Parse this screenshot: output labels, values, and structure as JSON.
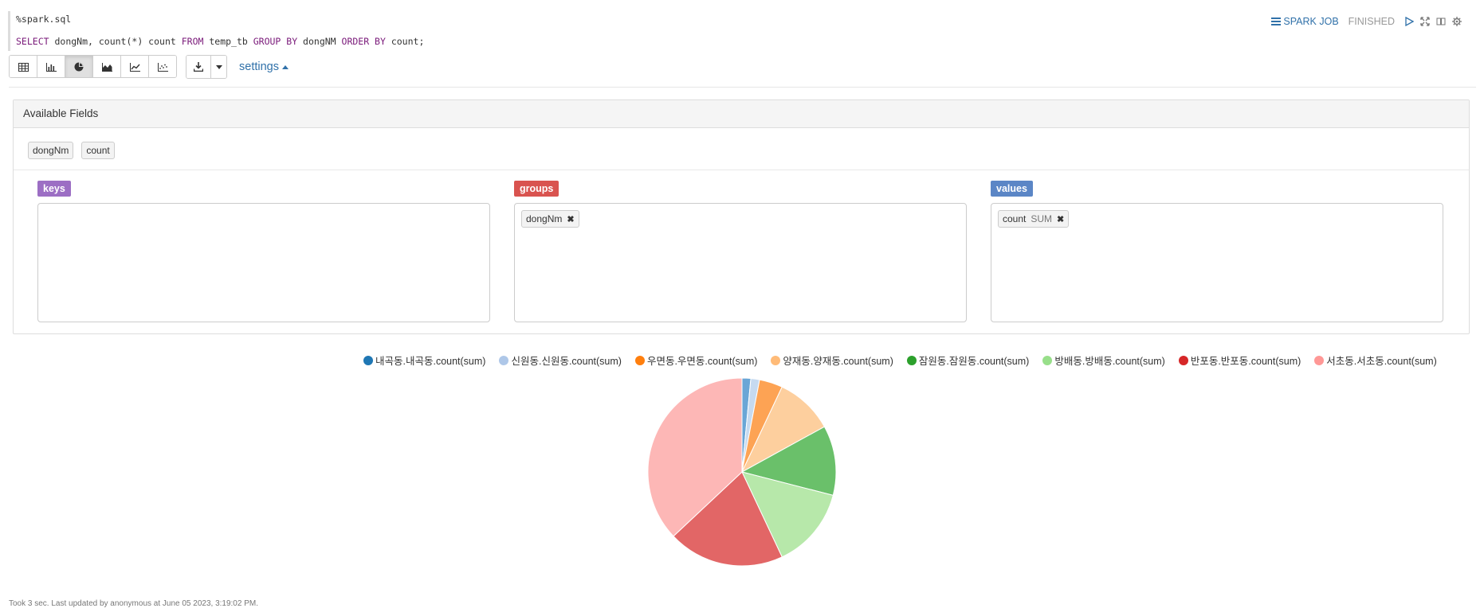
{
  "editor": {
    "interpreter": "%spark.sql",
    "query": {
      "select": "SELECT",
      "cols": " dongNm, count(*) count ",
      "from": "FROM",
      "table": " temp_tb ",
      "groupby": "GROUP BY",
      "groupcol": " dongNM ",
      "orderby": "ORDER BY",
      "ordercol": " count;"
    }
  },
  "status": {
    "spark_job": "SPARK JOB",
    "state": "FINISHED"
  },
  "toolbar": {
    "active_view": "pie",
    "views": [
      "table-icon",
      "bar-chart-icon",
      "pie-chart-icon",
      "area-chart-icon",
      "line-chart-icon",
      "scatter-chart-icon"
    ],
    "settings_label": "settings"
  },
  "panel": {
    "title": "Available Fields",
    "fields": [
      "dongNm",
      "count"
    ],
    "keys_label": "keys",
    "groups_label": "groups",
    "values_label": "values",
    "groups_item": "dongNm",
    "values_item": "count",
    "values_agg": "SUM",
    "colors": {
      "keys": "#9c6ec4",
      "groups": "#d9534f",
      "values": "#5b86c6"
    }
  },
  "chart_data": {
    "type": "pie",
    "series": [
      {
        "name": "내곡동.내곡동.count(sum)",
        "value": 1.5,
        "legend_color": "#1f77b4",
        "slice_color": "#6aa6d6"
      },
      {
        "name": "신원동.신원동.count(sum)",
        "value": 1.5,
        "legend_color": "#aec7e8",
        "slice_color": "#c6daf0"
      },
      {
        "name": "우면동.우면동.count(sum)",
        "value": 4,
        "legend_color": "#ff7f0e",
        "slice_color": "#fda354"
      },
      {
        "name": "양재동.양재동.count(sum)",
        "value": 10,
        "legend_color": "#ffbb78",
        "slice_color": "#fdcf9e"
      },
      {
        "name": "잠원동.잠원동.count(sum)",
        "value": 12,
        "legend_color": "#2ca02c",
        "slice_color": "#6ac06a"
      },
      {
        "name": "방배동.방배동.count(sum)",
        "value": 14,
        "legend_color": "#98df8a",
        "slice_color": "#b7e8aa"
      },
      {
        "name": "반포동.반포동.count(sum)",
        "value": 20,
        "legend_color": "#d62728",
        "slice_color": "#e26666"
      },
      {
        "name": "서초동.서초동.count(sum)",
        "value": 37,
        "legend_color": "#ff9896",
        "slice_color": "#fdb7b6"
      }
    ]
  },
  "footer": "Took 3 sec. Last updated by anonymous at June 05 2023, 3:19:02 PM."
}
